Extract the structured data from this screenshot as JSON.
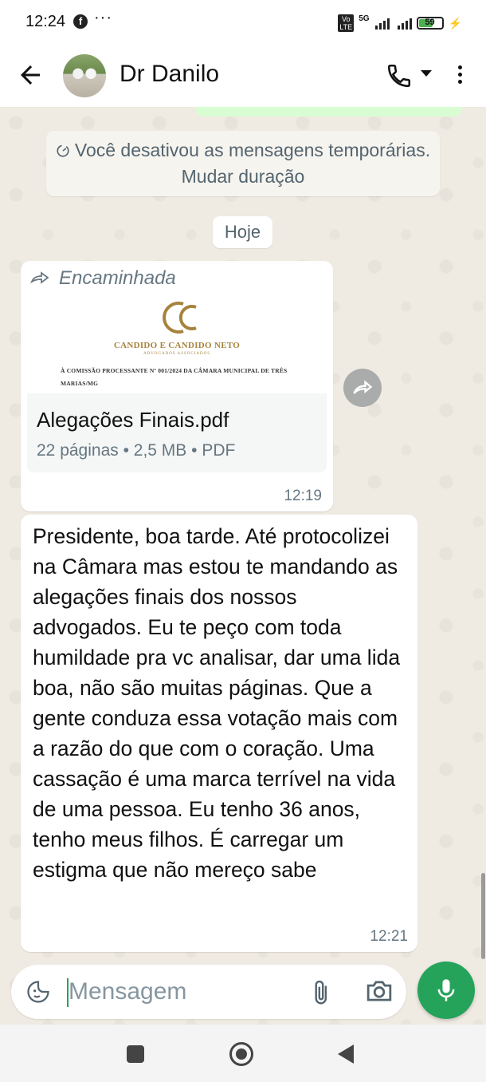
{
  "status_bar": {
    "time": "12:24",
    "app_icon": "facebook-icon",
    "more_notifications": "···",
    "volte": "Vo LTE",
    "network": "5G",
    "battery": "59",
    "battery_level": 0.59
  },
  "header": {
    "back_icon": "back-arrow-icon",
    "contact_name": "Dr Danilo",
    "call_icon": "phone-icon",
    "menu_icon": "more-vert-icon"
  },
  "chat": {
    "system_message": "Você desativou as mensagens temporárias. Mudar duração",
    "date_chip": "Hoje",
    "document_message": {
      "forwarded_label": "Encaminhada",
      "preview": {
        "firm_name": "CANDIDO E CANDIDO NETO",
        "firm_subtitle": "ADVOGADOS ASSOCIADOS",
        "text_line": "À COMISSÃO PROCESSANTE Nº 001/2024 DA CÂMARA MUNICIPAL DE TRÊS MARIAS/MG"
      },
      "file_name": "Alegações Finais.pdf",
      "meta": "22 páginas  •  2,5 MB  •  PDF",
      "time": "12:19"
    },
    "text_message": {
      "text": "Presidente, boa tarde. Até protocolizei na Câmara mas estou te mandando as alegações finais dos nossos advogados. Eu te peço com toda humildade pra vc analisar, dar uma lida boa, não são muitas páginas. Que a gente conduza essa votação mais com a razão do que com o coração. Uma cassação é uma marca terrível na vida de uma pessoa. Eu tenho 36 anos, tenho meus filhos. É carregar um estigma que não mereço sabe",
      "time": "12:21"
    }
  },
  "composer": {
    "placeholder": "Mensagem",
    "value": "",
    "emoji_icon": "sticker-icon",
    "attach_icon": "paperclip-icon",
    "camera_icon": "camera-icon",
    "mic_icon": "microphone-icon",
    "accent_color": "#25a35a"
  },
  "nav_bar": {
    "recents_icon": "square-icon",
    "home_icon": "circle-icon",
    "back_icon": "triangle-back-icon"
  }
}
